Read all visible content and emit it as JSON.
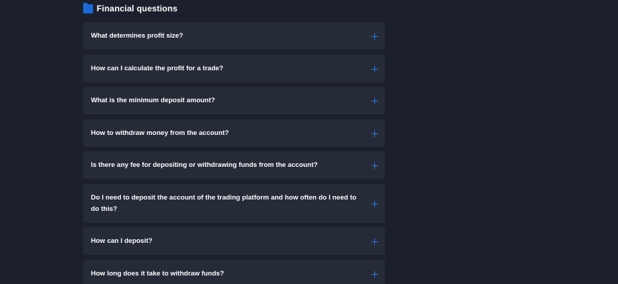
{
  "section": {
    "title": "Financial questions",
    "icon": "folder-icon",
    "accent_color": "#1a6bd8"
  },
  "faq": [
    {
      "question": "What determines profit size?"
    },
    {
      "question": "How can I calculate the profit for a trade?"
    },
    {
      "question": "What is the minimum deposit amount?"
    },
    {
      "question": "How to withdraw money from the account?"
    },
    {
      "question": "Is there any fee for depositing or withdrawing funds from the account?"
    },
    {
      "question": "Do I need to deposit the account of the trading platform and how often do I need to do this?"
    },
    {
      "question": "How can I deposit?"
    },
    {
      "question": "How long does it take to withdraw funds?"
    }
  ],
  "expand_icon": "plus-icon"
}
